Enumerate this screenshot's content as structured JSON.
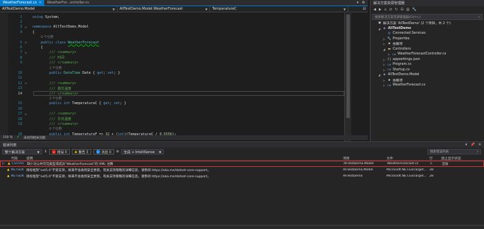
{
  "tabs": {
    "active": "WeatherForecast.cs",
    "inactive": "WeatherFor...ontroller.cs"
  },
  "navbar": {
    "project": "AllTestDemo.Model",
    "type": "AllTestDemo.Model.WeatherForecast",
    "member": "TemperatureC"
  },
  "editor": {
    "zoom": "100 %",
    "status": "未找到相关问题"
  },
  "code_lines": [
    {
      "n": "1",
      "html": "<span class='kw'>using</span> System;"
    },
    {
      "n": "2",
      "html": ""
    },
    {
      "n": "3",
      "html": "<span class='kw'>namespace</span> AllTestDemo.Model"
    },
    {
      "n": "4",
      "html": "{"
    },
    {
      "n": "",
      "refs": "0 个引用"
    },
    {
      "n": "5",
      "html": "    <span class='kw'>public</span> <span class='kw'>class</span> <span class='ty squig'>WeatherForecast</span>"
    },
    {
      "n": "6",
      "html": "    {"
    },
    {
      "n": "7",
      "html": "        <span class='cm'>/// &lt;summary&gt;</span>"
    },
    {
      "n": "8",
      "html": "        <span class='cm'>/// 时间</span>"
    },
    {
      "n": "9",
      "html": "        <span class='cm'>/// &lt;/summary&gt;</span>"
    },
    {
      "n": "",
      "refs": "1 个引用"
    },
    {
      "n": "10",
      "html": "        <span class='kw'>public</span> <span class='ty'>DateTime</span> Date { <span class='kw'>get</span>; <span class='kw'>set</span>; }"
    },
    {
      "n": "11",
      "html": ""
    },
    {
      "n": "12",
      "html": "        <span class='cm'>/// &lt;summary&gt;</span>"
    },
    {
      "n": "13",
      "html": "        <span class='cm'>/// 摄氏温度</span>"
    },
    {
      "n": "14",
      "html": "        <span class='cm'>/// &lt;/summary&gt;</span>",
      "current": true
    },
    {
      "n": "",
      "refs": "2 个引用"
    },
    {
      "n": "15",
      "html": "        <span class='kw'>public</span> <span class='kw'>int</span> TemperatureC { <span class='kw'>get</span>; <span class='kw'>set</span>; }"
    },
    {
      "n": "16",
      "html": ""
    },
    {
      "n": "17",
      "html": "        <span class='cm'>/// &lt;summary&gt;</span>"
    },
    {
      "n": "18",
      "html": "        <span class='cm'>/// 华氏温度</span>"
    },
    {
      "n": "19",
      "html": "        <span class='cm'>/// &lt;/summary&gt;</span>"
    },
    {
      "n": "",
      "refs": "0 个引用"
    },
    {
      "n": "20",
      "html": "        <span class='kw'>public</span> <span class='kw'>int</span> TemperatureF =&gt; <span class='nm'>32</span> + (<span class='kw'>int</span>)(TemperatureC / <span class='nm'>0.5556</span>);"
    }
  ],
  "solution_explorer": {
    "title": "解决方案资源管理器",
    "search_placeholder": "搜索解决方案资源管理器(Ctrl+;)",
    "items": [
      {
        "indent": 0,
        "arrow": "",
        "icon": "▣",
        "label": "解决方案 'AllTestDemo' (2 个项目，共 2 个)",
        "color": "#c5c5c5"
      },
      {
        "indent": 1,
        "arrow": "◢",
        "icon": "◆",
        "label": "AllTestDemo",
        "bold": true,
        "color": "#9b6bd6"
      },
      {
        "indent": 2,
        "arrow": "",
        "icon": "◎",
        "label": "Connected Services",
        "color": "#6fb3f2"
      },
      {
        "indent": 2,
        "arrow": "▷",
        "icon": "🔧",
        "label": "Properties",
        "color": "#bbbbbb"
      },
      {
        "indent": 2,
        "arrow": "▷",
        "icon": "▪",
        "label": "依赖项",
        "color": "#bbbbbb"
      },
      {
        "indent": 2,
        "arrow": "◢",
        "icon": "▬",
        "label": "Controllers",
        "color": "#dcb67a"
      },
      {
        "indent": 3,
        "arrow": "▷",
        "icon": "C#",
        "label": "WeatherForecastController.cs",
        "color": "#7fb1e8"
      },
      {
        "indent": 2,
        "arrow": "▷",
        "icon": "{}",
        "label": "appsettings.json",
        "color": "#cfcfcf"
      },
      {
        "indent": 2,
        "arrow": "▷",
        "icon": "C#",
        "label": "Program.cs",
        "color": "#7fb1e8"
      },
      {
        "indent": 2,
        "arrow": "▷",
        "icon": "C#",
        "label": "Startup.cs",
        "color": "#7fb1e8"
      },
      {
        "indent": 1,
        "arrow": "◢",
        "icon": "◆",
        "label": "AllTestDemo.Model",
        "color": "#9b6bd6"
      },
      {
        "indent": 2,
        "arrow": "▷",
        "icon": "▪",
        "label": "依赖项",
        "color": "#bbbbbb"
      },
      {
        "indent": 2,
        "arrow": "▷",
        "icon": "C#",
        "label": "WeatherForecast.cs",
        "color": "#7fb1e8"
      }
    ]
  },
  "error_list": {
    "title": "错误列表",
    "scope": "整个解决方案",
    "errors_label": "错误 0",
    "warnings_label": "警告 3",
    "messages_label": "消息 0",
    "build_filter": "生成 + IntelliSense",
    "search_placeholder": "搜索错误列表",
    "columns": {
      "code": "代码",
      "desc": "说明",
      "project": "项目",
      "file": "文件",
      "line": "行",
      "suppress": "禁止显示状态"
    },
    "rows": [
      {
        "expand": "▷",
        "code": "CS1591",
        "desc": "缺少对公共可见类型或成员\"WeatherForecast\"的 XML 注释",
        "project": "AllTestDemo.Model",
        "file": "WeatherForecast.cs",
        "line": "5",
        "suppress": "活动",
        "selected": true
      },
      {
        "expand": "",
        "code": "NETSDK",
        "desc": "目标框架\"net5.0\"不受支持，将来不会收到安全更新。有关支持策略的详细信息，请参阅 https://aka.ms/dotnet-core-support。",
        "project": "AllTestDemo.Model",
        "file": "Microsoft.NET.EolTarget...",
        "line": "28",
        "suppress": ""
      },
      {
        "expand": "",
        "code": "NETSDK",
        "desc": "目标框架\"net5.0\"不受支持，将来不会收到安全更新。有关支持策略的详细信息，请参阅 https://aka.ms/dotnet-core-support。",
        "project": "AllTestDemo",
        "file": "Microsoft.NET.EolTarget...",
        "line": "28",
        "suppress": ""
      }
    ]
  }
}
